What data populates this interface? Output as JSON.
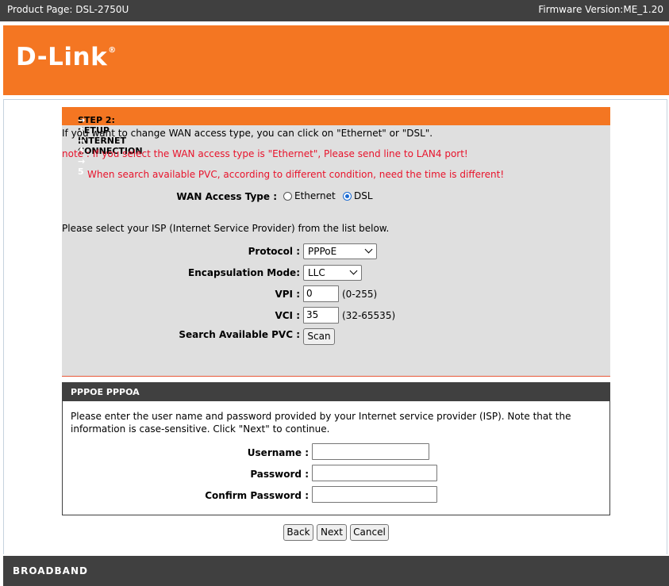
{
  "topbar": {
    "product": "Product Page: DSL-2750U",
    "firmware": "Firmware Version:ME_1.20"
  },
  "brand": {
    "logo": "D-Link",
    "mark": "®"
  },
  "step": {
    "title": "STEP 2: SETUP INTERNET CONNECTION",
    "arrows": "→ 3 → 4 → 5",
    "info": "If you want to change WAN access type, you can click on \"Ethernet\" or \"DSL\".",
    "note1": "note : If you select the WAN access type is \"Ethernet\", Please send line to LAN4 port!",
    "note2": "When search available PVC, according to different condition, need the time is different!",
    "wan_label": "WAN Access Type :",
    "wan_options": [
      "Ethernet",
      "DSL"
    ],
    "wan_selected": "DSL",
    "isp_text": "Please select your ISP (Internet Service Provider) from the list below.",
    "protocol_label": "Protocol :",
    "protocol_value": "PPPoE",
    "encap_label": "Encapsulation Mode:",
    "encap_value": "LLC",
    "vpi_label": "VPI :",
    "vpi_value": "0",
    "vpi_range": "(0-255)",
    "vci_label": "VCI :",
    "vci_value": "35",
    "vci_range": "(32-65535)",
    "pvc_label": "Search Available PVC :",
    "scan_label": "Scan"
  },
  "pppoe": {
    "title": "PPPOE PPPOA",
    "desc": "Please enter the user name and password provided by your Internet service provider (ISP). Note that the information is case-sensitive. Click \"Next\" to continue.",
    "username_label": "Username :",
    "password_label": "Password :",
    "confirm_label": "Confirm Password :",
    "username_value": "",
    "password_value": "",
    "confirm_value": ""
  },
  "buttons": {
    "back": "Back",
    "next": "Next",
    "cancel": "Cancel"
  },
  "footer": {
    "text": "BROADBAND"
  },
  "colors": {
    "orange": "#f47622",
    "dark": "#404040",
    "panel": "#dfdfdf",
    "note_red": "#e8132b"
  }
}
